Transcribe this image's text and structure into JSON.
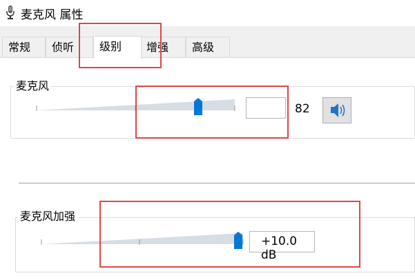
{
  "window": {
    "title": "麦克风 属性",
    "icon": "microphone-icon"
  },
  "tabs": [
    {
      "label": "常规",
      "active": false
    },
    {
      "label": "侦听",
      "active": false
    },
    {
      "label": "级别",
      "active": true
    },
    {
      "label": "增强",
      "active": false
    },
    {
      "label": "高级",
      "active": false
    }
  ],
  "microphone": {
    "label": "麦克风",
    "value_text": "82",
    "level_percent": 82,
    "mute_icon": "speaker-icon"
  },
  "boost": {
    "label": "麦克风加强",
    "value_text": "+10.0 dB",
    "level_percent": 100
  },
  "colors": {
    "thumb": "#0078d7",
    "highlight": "#e04545",
    "track": "#d6dde3"
  }
}
